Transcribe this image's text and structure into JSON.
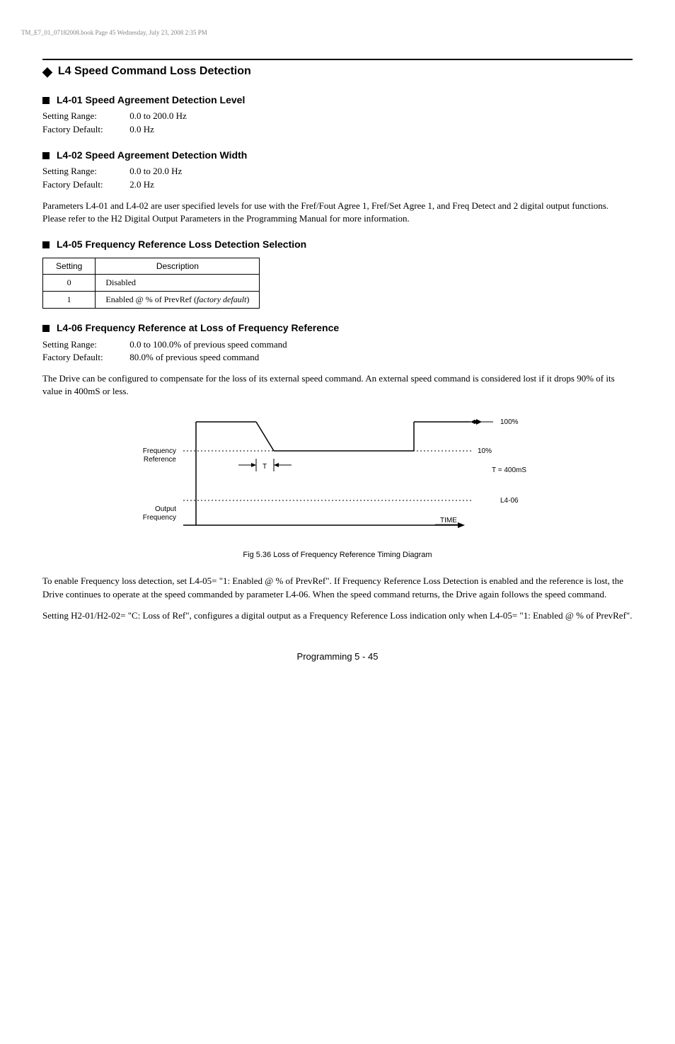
{
  "header_mark": "TM_E7_01_07182008.book  Page 45  Wednesday, July 23, 2008  2:35 PM",
  "section": {
    "title": "L4 Speed Command Loss Detection"
  },
  "sub1": {
    "title": "L4-01  Speed Agreement Detection Level",
    "range_label": "Setting Range:",
    "range_val": "0.0 to 200.0 Hz",
    "default_label": "Factory Default:",
    "default_val": "0.0 Hz"
  },
  "sub2": {
    "title": "L4-02  Speed Agreement Detection Width",
    "range_label": "Setting Range:",
    "range_val": "0.0 to 20.0 Hz",
    "default_label": "Factory Default:",
    "default_val": "2.0 Hz"
  },
  "para1": "Parameters L4-01 and L4-02 are user specified levels for use with the Fref/Fout Agree 1, Fref/Set Agree 1, and Freq Detect and 2 digital output functions. Please refer to the H2 Digital Output Parameters in the Programming Manual for more information.",
  "sub3": {
    "title": "L4-05  Frequency Reference Loss Detection Selection"
  },
  "table": {
    "h1": "Setting",
    "h2": "Description",
    "r1c1": "0",
    "r1c2": "Disabled",
    "r2c1": "1",
    "r2c2_a": "Enabled @ % of PrevRef (",
    "r2c2_b": "factory default",
    "r2c2_c": ")"
  },
  "sub4": {
    "title": "L4-06  Frequency Reference at Loss of Frequency Reference",
    "range_label": "Setting Range:",
    "range_val": "0.0 to 100.0% of previous speed command",
    "default_label": "Factory Default:",
    "default_val": "80.0% of previous speed command"
  },
  "para2": "The Drive can be configured to compensate for the loss of its external speed command. An external speed command is considered lost if it drops 90% of its value in 400mS or less.",
  "fig": {
    "freq_ref": "Frequency\nReference",
    "out_freq": "Output\nFrequency",
    "pct100": "100%",
    "pct10": "10%",
    "t_label": "T",
    "t_eq": "T = 400mS",
    "l406": "L4-06",
    "time": "TIME",
    "caption": "Fig 5.36  Loss of Frequency Reference Timing Diagram"
  },
  "para3": "To enable Frequency loss detection, set L4-05= \"1: Enabled @ % of PrevRef\". If Frequency Reference Loss Detection is enabled and the reference is lost, the Drive continues to operate at the speed commanded by parameter L4-06. When the speed command returns, the Drive again follows the speed command.",
  "para4": "Setting H2-01/H2-02= \"C: Loss of Ref\", configures a digital output as a Frequency Reference Loss indication only when L4-05= \"1: Enabled @ % of PrevRef\".",
  "footer": "Programming  5 - 45"
}
